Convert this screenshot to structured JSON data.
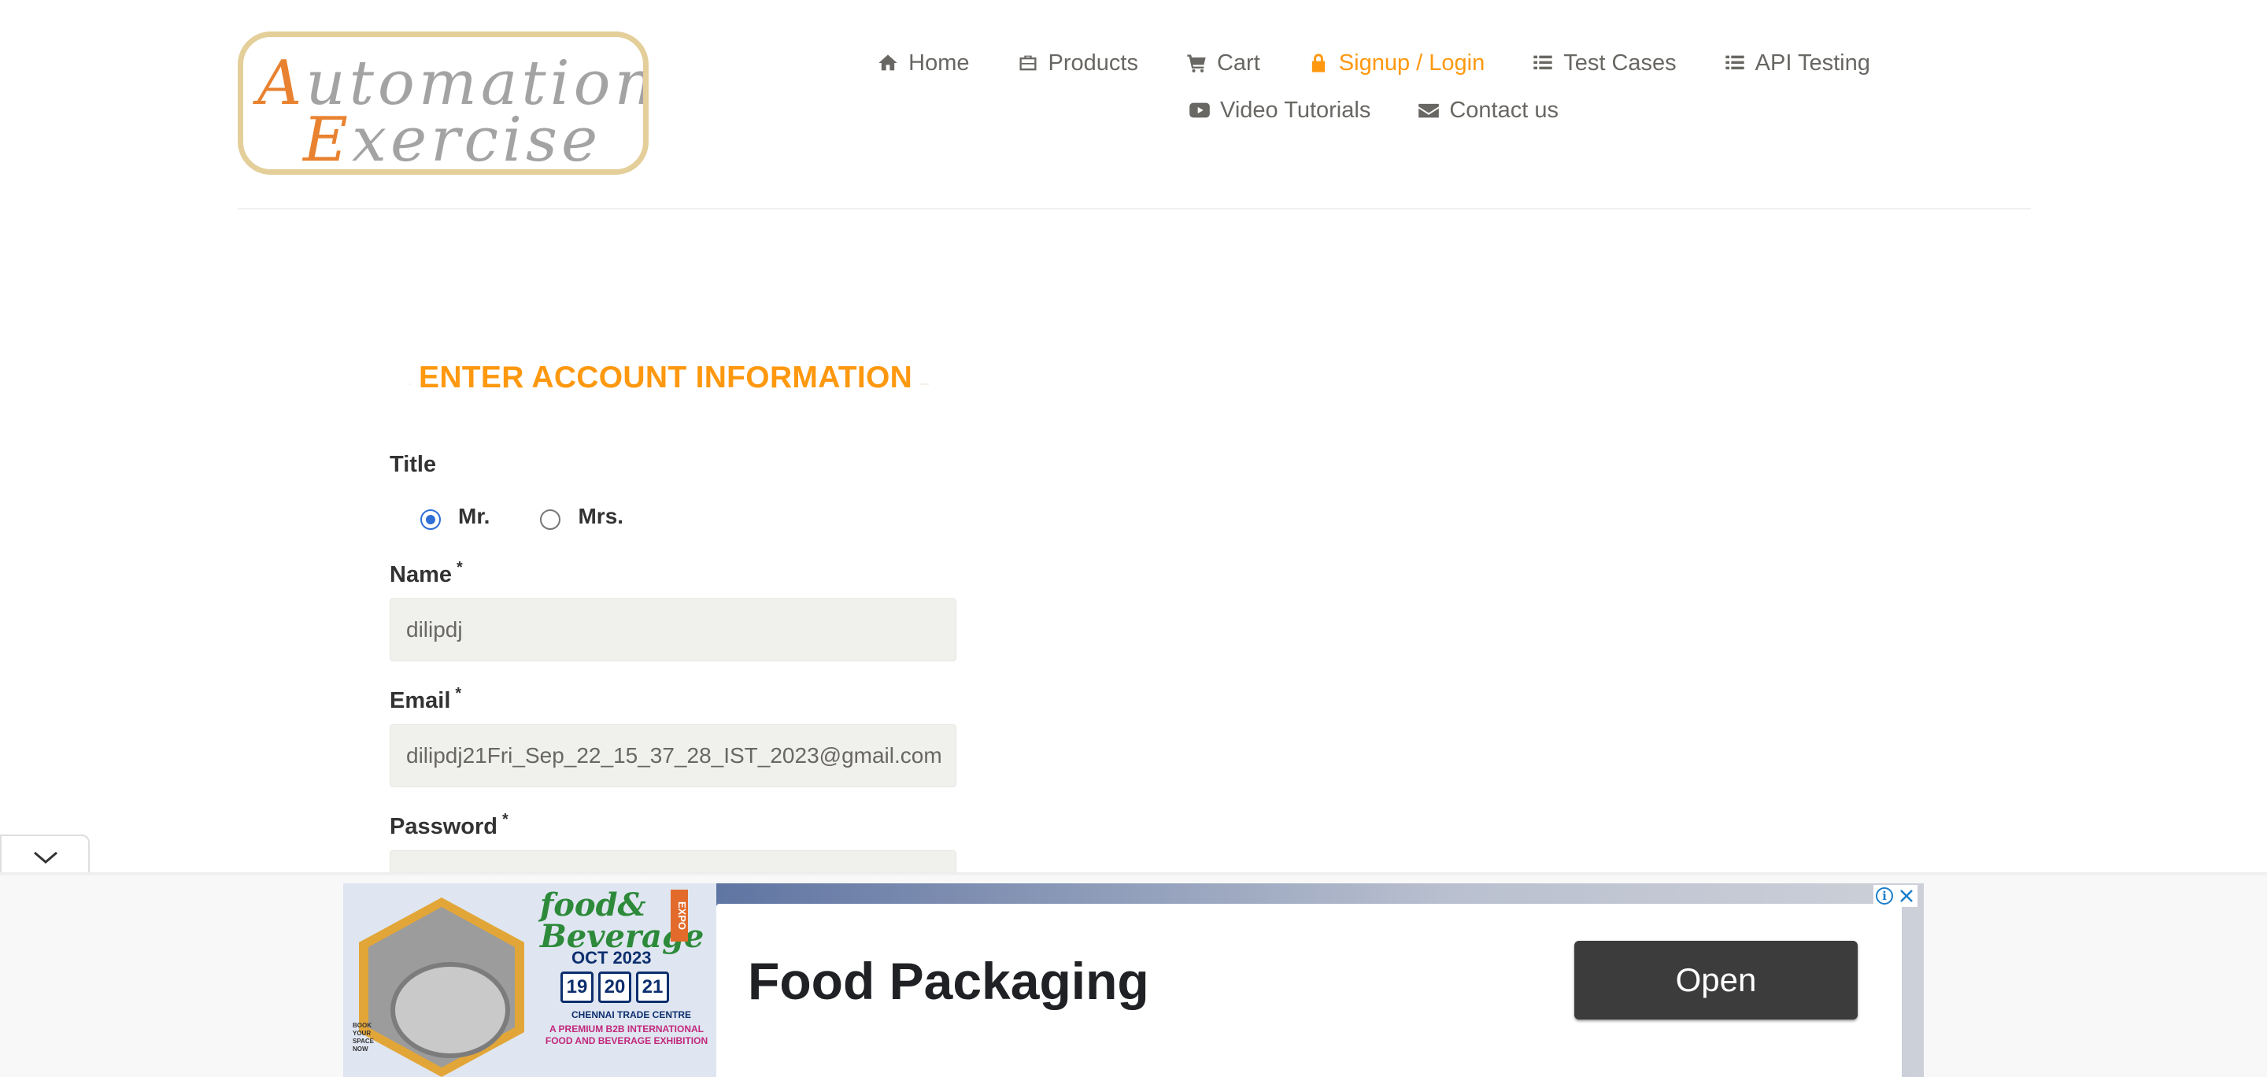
{
  "logo": {
    "line1": "Automation",
    "line2": "Exercise"
  },
  "nav": {
    "row1": [
      {
        "label": "Home",
        "icon": "home-icon"
      },
      {
        "label": "Products",
        "icon": "briefcase-icon"
      },
      {
        "label": "Cart",
        "icon": "cart-icon"
      },
      {
        "label": "Signup / Login",
        "icon": "lock-icon",
        "active": true
      },
      {
        "label": "Test Cases",
        "icon": "list-icon"
      },
      {
        "label": "API Testing",
        "icon": "list-icon"
      }
    ],
    "row2": [
      {
        "label": "Video Tutorials",
        "icon": "youtube-play-icon"
      },
      {
        "label": "Contact us",
        "icon": "envelope-icon"
      }
    ],
    "active_color": "#fe980f"
  },
  "form": {
    "heading": "ENTER ACCOUNT INFORMATION",
    "title_label": "Title",
    "title_options": [
      {
        "label": "Mr.",
        "checked": true
      },
      {
        "label": "Mrs.",
        "checked": false
      }
    ],
    "name_label": "Name",
    "name_value": "dilipdj",
    "email_label": "Email",
    "email_value": "dilipdj21Fri_Sep_22_15_37_28_IST_2023@gmail.com",
    "password_label": "Password",
    "required_mark": "*"
  },
  "ad": {
    "brand_line1": "food&",
    "brand_line2": "Beverage",
    "expo": "EXPO",
    "month": "OCT 2023",
    "days": [
      "19",
      "20",
      "21"
    ],
    "venue": "CHENNAI TRADE CENTRE",
    "tagline": "A PREMIUM B2B INTERNATIONAL FOOD AND BEVERAGE EXHIBITION",
    "book": "BOOK YOUR SPACE NOW",
    "headline": "Food Packaging",
    "cta": "Open"
  }
}
